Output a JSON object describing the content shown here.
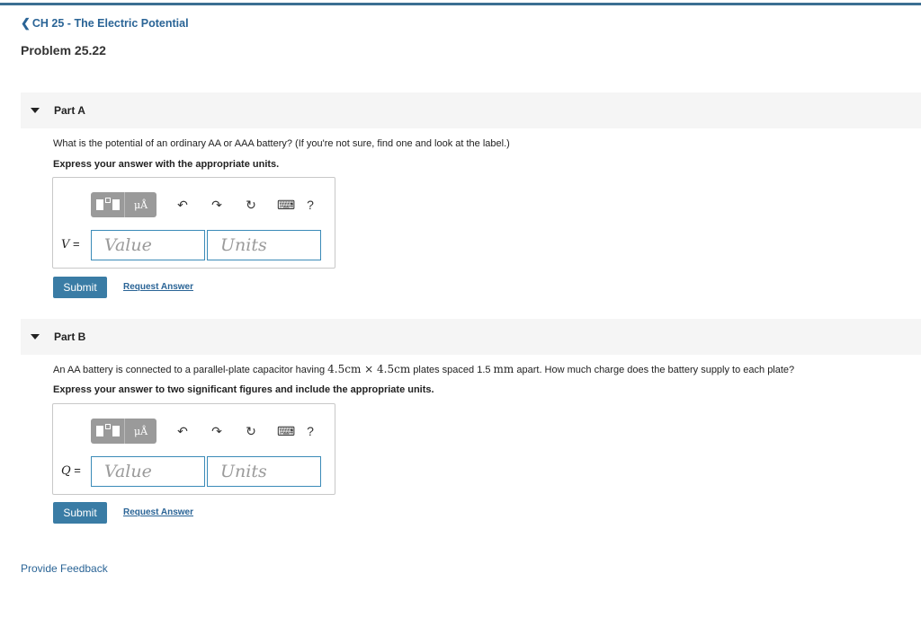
{
  "nav": {
    "back_label": "CH 25 - The Electric Potential"
  },
  "problem": {
    "title": "Problem 25.22"
  },
  "parts": [
    {
      "label": "Part A",
      "question": "What is the potential of an ordinary AA or AAA battery? (If you're not sure, find one and look at the label.)",
      "instruction": "Express your answer with the appropriate units.",
      "variable": "V",
      "equals": "=",
      "value_placeholder": "Value",
      "units_placeholder": "Units",
      "submit_label": "Submit",
      "request_label": "Request Answer"
    },
    {
      "label": "Part B",
      "question_pre": "An AA battery is connected to a parallel-plate capacitor having ",
      "question_math1": "4.5cm × 4.5cm",
      "question_mid": " plates spaced 1.5 ",
      "question_math2": "mm",
      "question_post": " apart. How much charge does the battery supply to each plate?",
      "instruction": "Express your answer to two significant figures and include the appropriate units.",
      "variable": "Q",
      "equals": "=",
      "value_placeholder": "Value",
      "units_placeholder": "Units",
      "submit_label": "Submit",
      "request_label": "Request Answer"
    }
  ],
  "toolbar": {
    "units_label": "μÅ",
    "undo_icon": "↶",
    "redo_icon": "↷",
    "reset_icon": "↻",
    "keyboard_icon": "⌨",
    "help_label": "?"
  },
  "footer": {
    "feedback_label": "Provide Feedback"
  },
  "colors": {
    "accent": "#3a7ca5",
    "link": "#2a6496",
    "top_bar": "#3b6f92",
    "input_border": "#3b8bb8"
  }
}
